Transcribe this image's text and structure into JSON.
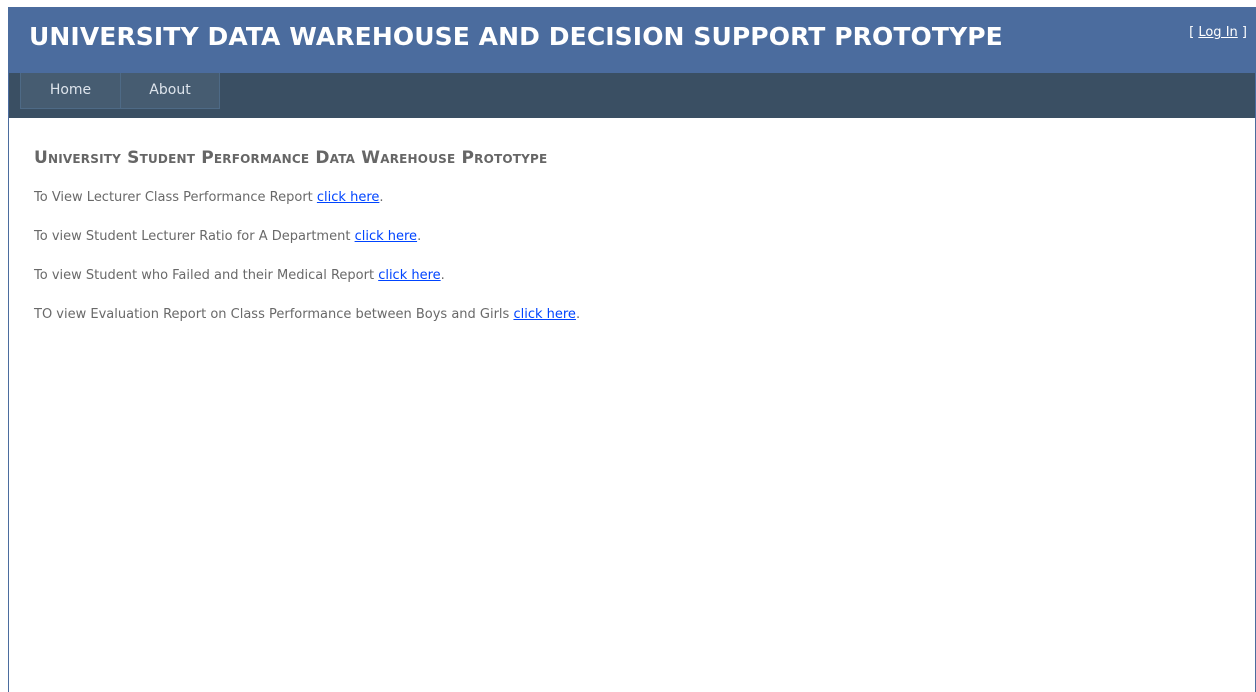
{
  "header": {
    "title": "UNIVERSITY DATA WAREHOUSE AND DECISION SUPPORT PROTOTYPE",
    "login_open": "[ ",
    "login_label": "Log In",
    "login_close": " ]"
  },
  "nav": {
    "items": [
      {
        "label": "Home"
      },
      {
        "label": "About"
      }
    ]
  },
  "main": {
    "heading": "University Student Performance Data Warehouse Prototype",
    "links": [
      {
        "text": "To View Lecturer Class Performance Report ",
        "link": "click here",
        "suffix": "."
      },
      {
        "text": "To view Student Lecturer Ratio for A Department ",
        "link": "click here",
        "suffix": "."
      },
      {
        "text": "To view Student who Failed and their Medical Report ",
        "link": "click here",
        "suffix": "."
      },
      {
        "text": "TO view Evaluation Report on Class Performance between Boys and Girls ",
        "link": "click here",
        "suffix": "."
      }
    ]
  }
}
